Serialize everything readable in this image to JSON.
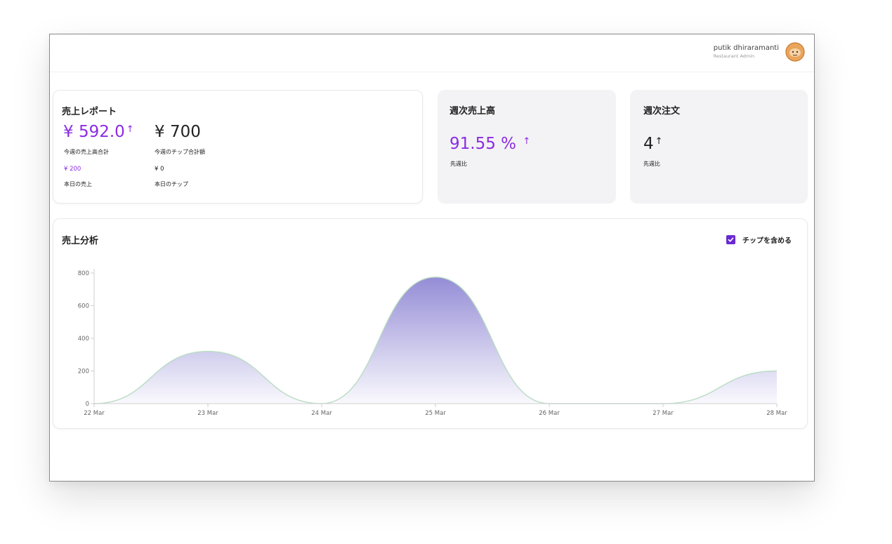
{
  "user": {
    "name": "putik dhiraramanti",
    "role": "Restaurant Admin"
  },
  "report": {
    "title": "売上レポート",
    "week_sales": "¥ 592.0",
    "week_sales_label": "今週の売上高合計",
    "week_tips": "¥ 700",
    "week_tips_label": "今週のチップ合計額",
    "today_sales": "¥ 200",
    "today_sales_label": "本日の売上",
    "today_tips": "¥ 0",
    "today_tips_label": "本日のチップ"
  },
  "weekly_sales": {
    "title": "週次売上高",
    "value": "91.55 %",
    "label": "先週比"
  },
  "weekly_orders": {
    "title": "週次注文",
    "value": "4",
    "label": "先週比"
  },
  "arrow_glyph": "↑",
  "analysis": {
    "title": "売上分析",
    "include_tips_label": "チップを含める",
    "include_tips_checked": true
  },
  "colors": {
    "accent": "#8b2be2",
    "checkbox": "#6a2ad1",
    "area": "#8f87d4",
    "line": "#b9dcc3"
  },
  "chart_data": {
    "type": "area",
    "categories": [
      "22 Mar",
      "23 Mar",
      "24 Mar",
      "25 Mar",
      "26 Mar",
      "27 Mar",
      "28 Mar"
    ],
    "values": [
      0,
      320,
      0,
      775,
      0,
      0,
      200
    ],
    "yticks": [
      0,
      200,
      400,
      600,
      800
    ],
    "ylim": [
      0,
      800
    ],
    "grid": false,
    "legend": "none"
  }
}
